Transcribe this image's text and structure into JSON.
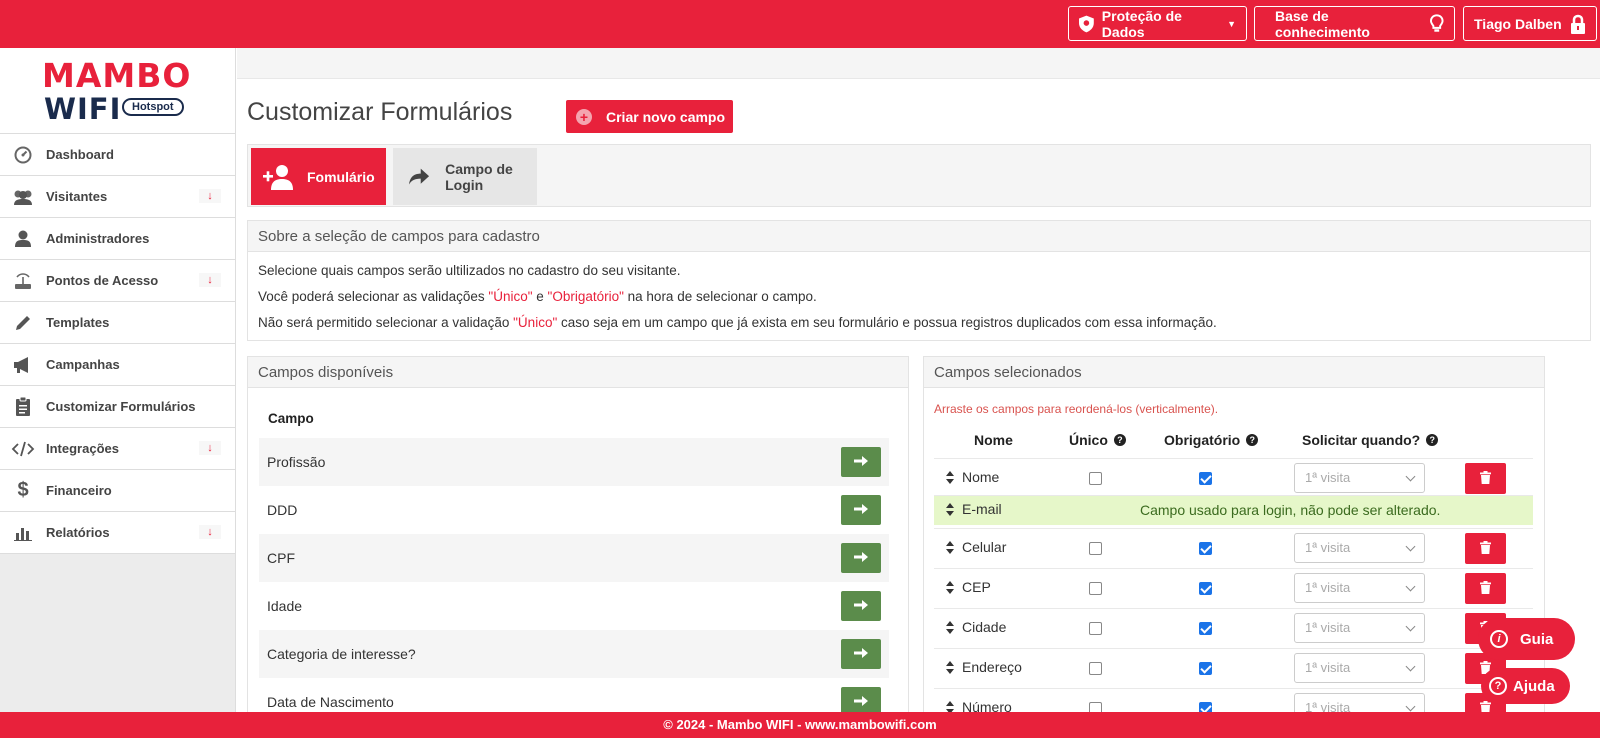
{
  "topbar": {
    "protecao": "Proteção de Dados",
    "base": "Base de conhecimento",
    "user": "Tiago Dalben"
  },
  "logo": {
    "mambo": "MAMBO",
    "wifi": "WIFI",
    "hotspot": "Hotspot"
  },
  "sidebar": {
    "items": [
      {
        "label": "Dashboard",
        "icon": "dashboard-icon"
      },
      {
        "label": "Visitantes",
        "icon": "users-icon",
        "expand": "↓"
      },
      {
        "label": "Administradores",
        "icon": "user-icon"
      },
      {
        "label": "Pontos de Acesso",
        "icon": "router-icon",
        "expand": "↓"
      },
      {
        "label": "Templates",
        "icon": "pencil-icon"
      },
      {
        "label": "Campanhas",
        "icon": "megaphone-icon"
      },
      {
        "label": "Customizar Formulários",
        "icon": "clipboard-icon"
      },
      {
        "label": "Integrações",
        "icon": "code-icon",
        "expand": "↓"
      },
      {
        "label": "Financeiro",
        "icon": "dollar-icon"
      },
      {
        "label": "Relatórios",
        "icon": "bar-chart-icon",
        "expand": "↓"
      }
    ]
  },
  "main": {
    "title": "Customizar Formulários",
    "new_field": "Criar novo campo",
    "tabs": [
      {
        "label": "Fomulário"
      },
      {
        "label": "Campo de Login"
      }
    ],
    "about": {
      "heading": "Sobre a seleção de campos para cadastro",
      "line1": "Selecione quais campos serão ultilizados no cadastro do seu visitante.",
      "line2_a": "Você poderá selecionar as validações ",
      "line2_b": "\"Único\"",
      "line2_c": " e ",
      "line2_d": "\"Obrigatório\"",
      "line2_e": " na hora de selecionar o campo.",
      "line3_a": "Não será permitido selecionar a validação ",
      "line3_b": "\"Único\"",
      "line3_c": " caso seja em um campo que já exista em seu formulário e possua registros duplicados com essa informação."
    },
    "available": {
      "heading": "Campos disponíveis",
      "col": "Campo",
      "rows": [
        "Profissão",
        "DDD",
        "CPF",
        "Idade",
        "Categoria de interesse?",
        "Data de Nascimento"
      ]
    },
    "selected": {
      "heading": "Campos selecionados",
      "hint": "Arraste os campos para reordená-los (verticalmente).",
      "cols": {
        "nome": "Nome",
        "unico": "Único",
        "obrigatorio": "Obrigatório",
        "solicitar": "Solicitar quando?"
      },
      "email_msg": "Campo usado para login, não pode ser alterado.",
      "rows": [
        {
          "name": "Nome",
          "unique": false,
          "required": true,
          "when": "1ª visita"
        },
        {
          "name": "E-mail"
        },
        {
          "name": "Celular",
          "unique": false,
          "required": true,
          "when": "1ª visita"
        },
        {
          "name": "CEP",
          "unique": false,
          "required": true,
          "when": "1ª visita"
        },
        {
          "name": "Cidade",
          "unique": false,
          "required": true,
          "when": "1ª visita"
        },
        {
          "name": "Endereço",
          "unique": false,
          "required": true,
          "when": "1ª visita"
        },
        {
          "name": "Número",
          "unique": false,
          "required": true,
          "when": "1ª visita"
        }
      ]
    }
  },
  "fab": {
    "guia": "Guia",
    "ajuda": "Ajuda"
  },
  "footer": "© 2024 - Mambo WIFI - www.mambowifi.com",
  "colors": {
    "brand": "#e8213b",
    "go": "#5b8c4b",
    "email_bg": "#e6f7c9"
  }
}
